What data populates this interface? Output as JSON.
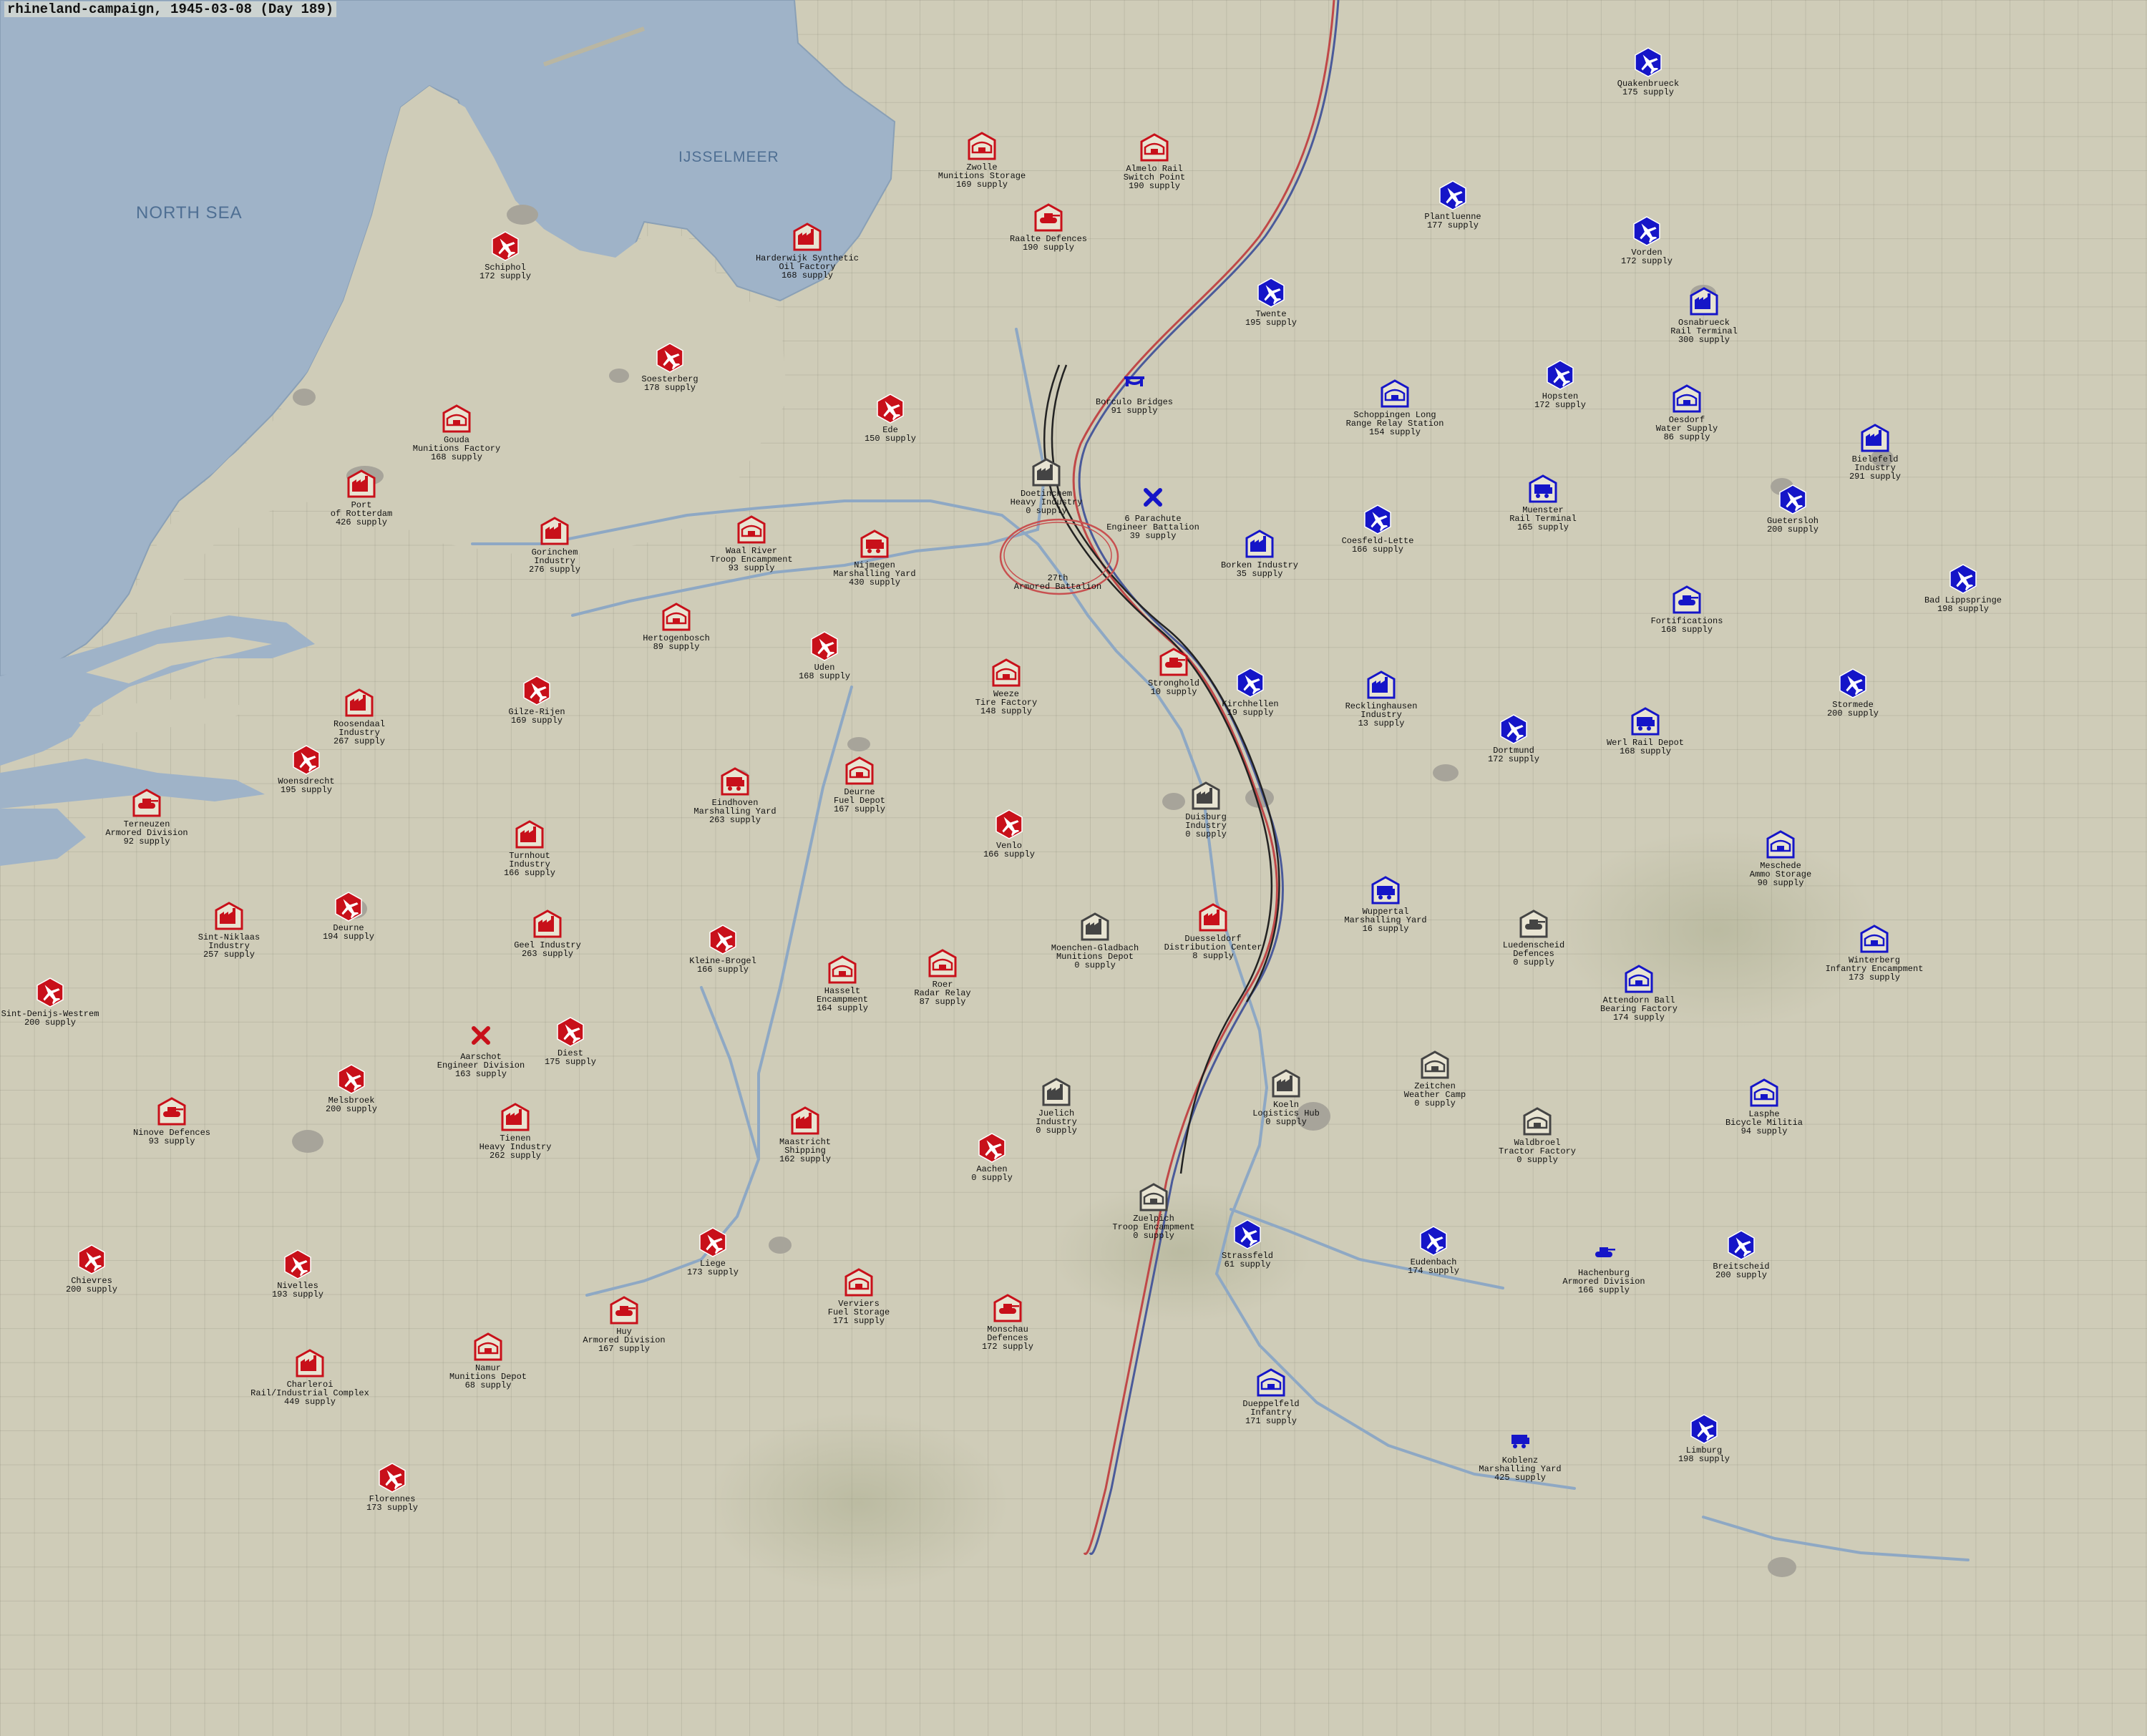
{
  "title": "rhineland-campaign, 1945-03-08 (Day 189)",
  "sea_labels": [
    {
      "id": "north-sea",
      "text": "NORTH SEA"
    },
    {
      "id": "ijsselmeer",
      "text": "IJSSELMEER"
    }
  ],
  "colors": {
    "land": "#cfccb8",
    "water": "#9fb3c8",
    "allied_red": "#c8101a",
    "axis_blue": "#1515c8",
    "neutral_gray": "#444444",
    "frontline_red": "#c04040",
    "frontline_blue": "#5a6aa0"
  },
  "units": [
    {
      "name": "Zwolle",
      "sub": "Munitions Storage",
      "supply": "169 supply",
      "side": "red",
      "shape": "house",
      "icon": "bunker-icon"
    },
    {
      "name": "Almelo Rail",
      "sub": "Switch Point",
      "supply": "190 supply",
      "side": "red",
      "shape": "house",
      "icon": "bunker-icon"
    },
    {
      "name": "Raalte Defences",
      "sub": "",
      "supply": "190 supply",
      "side": "red",
      "shape": "house",
      "icon": "tank-icon"
    },
    {
      "name": "Schiphol",
      "sub": "",
      "supply": "172 supply",
      "side": "red",
      "shape": "hex",
      "icon": "airfield-icon"
    },
    {
      "name": "Harderwijk Synthetic",
      "sub": "Oil Factory",
      "supply": "168 supply",
      "side": "red",
      "shape": "house",
      "icon": "factory-icon"
    },
    {
      "name": "Soesterberg",
      "sub": "",
      "supply": "178 supply",
      "side": "red",
      "shape": "hex",
      "icon": "airfield-icon"
    },
    {
      "name": "Gouda",
      "sub": "Munitions Factory",
      "supply": "168 supply",
      "side": "red",
      "shape": "house",
      "icon": "bunker-icon"
    },
    {
      "name": "Ede",
      "sub": "",
      "supply": "150 supply",
      "side": "red",
      "shape": "hex",
      "icon": "airfield-icon"
    },
    {
      "name": "Port",
      "sub": "of Rotterdam",
      "supply": "426 supply",
      "side": "red",
      "shape": "house",
      "icon": "factory-icon"
    },
    {
      "name": "Gorinchem",
      "sub": "Industry",
      "supply": "276 supply",
      "side": "red",
      "shape": "house",
      "icon": "factory-icon"
    },
    {
      "name": "Waal River",
      "sub": "Troop Encampment",
      "supply": "93 supply",
      "side": "red",
      "shape": "house",
      "icon": "bunker-icon"
    },
    {
      "name": "Nijmegen",
      "sub": "Marshalling Yard",
      "supply": "430 supply",
      "side": "red",
      "shape": "house",
      "icon": "train-icon"
    },
    {
      "name": "Doetinchem",
      "sub": "Heavy Industry",
      "supply": "0 supply",
      "side": "gray",
      "shape": "house",
      "icon": "factory-icon"
    },
    {
      "name": "",
      "sub": "27th\nArmored Battalion",
      "supply": "",
      "side": "red",
      "shape": "none",
      "icon": ""
    },
    {
      "name": "Hertogenbosch",
      "sub": "",
      "supply": "89 supply",
      "side": "red",
      "shape": "house",
      "icon": "bunker-icon"
    },
    {
      "name": "Uden",
      "sub": "",
      "supply": "168 supply",
      "side": "red",
      "shape": "hex",
      "icon": "airfield-icon"
    },
    {
      "name": "Gilze-Rijen",
      "sub": "",
      "supply": "169 supply",
      "side": "red",
      "shape": "hex",
      "icon": "airfield-icon"
    },
    {
      "name": "Roosendaal",
      "sub": "Industry",
      "supply": "267 supply",
      "side": "red",
      "shape": "house",
      "icon": "factory-icon"
    },
    {
      "name": "Woensdrecht",
      "sub": "",
      "supply": "195 supply",
      "side": "red",
      "shape": "hex",
      "icon": "airfield-icon"
    },
    {
      "name": "Weeze",
      "sub": "Tire Factory",
      "supply": "148 supply",
      "side": "red",
      "shape": "house",
      "icon": "bunker-icon"
    },
    {
      "name": "Stronghold",
      "sub": "",
      "supply": "10 supply",
      "side": "red",
      "shape": "house",
      "icon": "tank-icon"
    },
    {
      "name": "Eindhoven",
      "sub": "Marshalling Yard",
      "supply": "263 supply",
      "side": "red",
      "shape": "house",
      "icon": "train-icon"
    },
    {
      "name": "Deurne",
      "sub": "Fuel Depot",
      "supply": "167 supply",
      "side": "red",
      "shape": "house",
      "icon": "bunker-icon"
    },
    {
      "name": "Terneuzen",
      "sub": "Armored Division",
      "supply": "92 supply",
      "side": "red",
      "shape": "house",
      "icon": "tank-icon"
    },
    {
      "name": "Turnhout",
      "sub": "Industry",
      "supply": "166 supply",
      "side": "red",
      "shape": "house",
      "icon": "factory-icon"
    },
    {
      "name": "Venlo",
      "sub": "",
      "supply": "166 supply",
      "side": "red",
      "shape": "hex",
      "icon": "airfield-icon"
    },
    {
      "name": "Duisburg",
      "sub": "Industry",
      "supply": "0 supply",
      "side": "gray",
      "shape": "house",
      "icon": "factory-icon"
    },
    {
      "name": "Sint-Niklaas",
      "sub": "Industry",
      "supply": "257 supply",
      "side": "red",
      "shape": "house",
      "icon": "factory-icon"
    },
    {
      "name": "Deurne",
      "sub": "",
      "supply": "194 supply",
      "side": "red",
      "shape": "hex",
      "icon": "airfield-icon"
    },
    {
      "name": "Geel Industry",
      "sub": "",
      "supply": "263 supply",
      "side": "red",
      "shape": "house",
      "icon": "factory-icon"
    },
    {
      "name": "Kleine-Brogel",
      "sub": "",
      "supply": "166 supply",
      "side": "red",
      "shape": "hex",
      "icon": "airfield-icon"
    },
    {
      "name": "Roer",
      "sub": "Radar Relay",
      "supply": "87 supply",
      "side": "red",
      "shape": "house",
      "icon": "bunker-icon"
    },
    {
      "name": "Hasselt",
      "sub": "Encampment",
      "supply": "164 supply",
      "side": "red",
      "shape": "house",
      "icon": "bunker-icon"
    },
    {
      "name": "Moenchen-Gladbach",
      "sub": "Munitions Depot",
      "supply": "0 supply",
      "side": "gray",
      "shape": "house",
      "icon": "factory-icon"
    },
    {
      "name": "Duesseldorf",
      "sub": "Distribution Center",
      "supply": "8 supply",
      "side": "red",
      "shape": "house",
      "icon": "factory-icon"
    },
    {
      "name": "Sint-Denijs-Westrem",
      "sub": "",
      "supply": "200 supply",
      "side": "red",
      "shape": "hex",
      "icon": "airfield-icon"
    },
    {
      "name": "Aarschot",
      "sub": "Engineer Division",
      "supply": "163 supply",
      "side": "red",
      "shape": "none",
      "icon": "engineer-icon"
    },
    {
      "name": "Diest",
      "sub": "",
      "supply": "175 supply",
      "side": "red",
      "shape": "hex",
      "icon": "airfield-icon"
    },
    {
      "name": "Melsbroek",
      "sub": "",
      "supply": "200 supply",
      "side": "red",
      "shape": "hex",
      "icon": "airfield-icon"
    },
    {
      "name": "Ninove Defences",
      "sub": "",
      "supply": "93 supply",
      "side": "red",
      "shape": "house",
      "icon": "tank-icon"
    },
    {
      "name": "Tienen",
      "sub": "Heavy Industry",
      "supply": "262 supply",
      "side": "red",
      "shape": "house",
      "icon": "factory-icon"
    },
    {
      "name": "Maastricht",
      "sub": "Shipping",
      "supply": "162 supply",
      "side": "red",
      "shape": "house",
      "icon": "factory-icon"
    },
    {
      "name": "Juelich",
      "sub": "Industry",
      "supply": "0 supply",
      "side": "gray",
      "shape": "house",
      "icon": "factory-icon"
    },
    {
      "name": "Aachen",
      "sub": "",
      "supply": "0 supply",
      "side": "red",
      "shape": "hex",
      "icon": "airfield-icon"
    },
    {
      "name": "Koeln",
      "sub": "Logistics Hub",
      "supply": "0 supply",
      "side": "gray",
      "shape": "house",
      "icon": "factory-icon"
    },
    {
      "name": "Zuelpich",
      "sub": "Troop Encampment",
      "supply": "0 supply",
      "side": "gray",
      "shape": "house",
      "icon": "bunker-icon"
    },
    {
      "name": "Chievres",
      "sub": "",
      "supply": "200 supply",
      "side": "red",
      "shape": "hex",
      "icon": "airfield-icon"
    },
    {
      "name": "Nivelles",
      "sub": "",
      "supply": "193 supply",
      "side": "red",
      "shape": "hex",
      "icon": "airfield-icon"
    },
    {
      "name": "Liege",
      "sub": "",
      "supply": "173 supply",
      "side": "red",
      "shape": "hex",
      "icon": "airfield-icon"
    },
    {
      "name": "Verviers",
      "sub": "Fuel Storage",
      "supply": "171 supply",
      "side": "red",
      "shape": "house",
      "icon": "bunker-icon"
    },
    {
      "name": "Monschau",
      "sub": "Defences",
      "supply": "172 supply",
      "side": "red",
      "shape": "house",
      "icon": "tank-icon"
    },
    {
      "name": "Huy",
      "sub": "Armored Division",
      "supply": "167 supply",
      "side": "red",
      "shape": "house",
      "icon": "tank-icon"
    },
    {
      "name": "Namur",
      "sub": "Munitions Depot",
      "supply": "68 supply",
      "side": "red",
      "shape": "house",
      "icon": "bunker-icon"
    },
    {
      "name": "Charleroi",
      "sub": "Rail/Industrial Complex",
      "supply": "449 supply",
      "side": "red",
      "shape": "house",
      "icon": "factory-icon"
    },
    {
      "name": "Florennes",
      "sub": "",
      "supply": "173 supply",
      "side": "red",
      "shape": "hex",
      "icon": "airfield-icon"
    },
    {
      "name": "Quakenbrueck",
      "sub": "",
      "supply": "175 supply",
      "side": "blue",
      "shape": "hex",
      "icon": "airfield-icon"
    },
    {
      "name": "Plantluenne",
      "sub": "",
      "supply": "177 supply",
      "side": "blue",
      "shape": "hex",
      "icon": "airfield-icon"
    },
    {
      "name": "Vorden",
      "sub": "",
      "supply": "172 supply",
      "side": "blue",
      "shape": "hex",
      "icon": "airfield-icon"
    },
    {
      "name": "Twente",
      "sub": "",
      "supply": "195 supply",
      "side": "blue",
      "shape": "hex",
      "icon": "airfield-icon"
    },
    {
      "name": "Osnabrueck",
      "sub": "Rail Terminal",
      "supply": "300 supply",
      "side": "blue",
      "shape": "house",
      "icon": "factory-icon"
    },
    {
      "name": "Borculo Bridges",
      "sub": "",
      "supply": "91 supply",
      "side": "blue",
      "shape": "none",
      "icon": "bridge-icon"
    },
    {
      "name": "Hopsten",
      "sub": "",
      "supply": "172 supply",
      "side": "blue",
      "shape": "hex",
      "icon": "airfield-icon"
    },
    {
      "name": "Schoppingen Long",
      "sub": "Range Relay Station",
      "supply": "154 supply",
      "side": "blue",
      "shape": "house",
      "icon": "bunker-icon"
    },
    {
      "name": "Oesdorf",
      "sub": "Water Supply",
      "supply": "86 supply",
      "side": "blue",
      "shape": "house",
      "icon": "bunker-icon"
    },
    {
      "name": "Bielefeld",
      "sub": "Industry",
      "supply": "291 supply",
      "side": "blue",
      "shape": "house",
      "icon": "factory-icon"
    },
    {
      "name": "6 Parachute",
      "sub": "Engineer Battalion",
      "supply": "39 supply",
      "side": "blue",
      "shape": "none",
      "icon": "engineer-icon"
    },
    {
      "name": "Muenster",
      "sub": "Rail Terminal",
      "supply": "165 supply",
      "side": "blue",
      "shape": "house",
      "icon": "train-icon"
    },
    {
      "name": "Guetersloh",
      "sub": "",
      "supply": "200 supply",
      "side": "blue",
      "shape": "hex",
      "icon": "airfield-icon"
    },
    {
      "name": "Coesfeld-Lette",
      "sub": "",
      "supply": "166 supply",
      "side": "blue",
      "shape": "hex",
      "icon": "airfield-icon"
    },
    {
      "name": "Borken Industry",
      "sub": "",
      "supply": "35 supply",
      "side": "blue",
      "shape": "house",
      "icon": "factory-icon"
    },
    {
      "name": "Fortifications",
      "sub": "",
      "supply": "168 supply",
      "side": "blue",
      "shape": "house",
      "icon": "tank-icon"
    },
    {
      "name": "Bad Lippspringe",
      "sub": "",
      "supply": "198 supply",
      "side": "blue",
      "shape": "hex",
      "icon": "airfield-icon"
    },
    {
      "name": "Kirchhellen",
      "sub": "",
      "supply": "19 supply",
      "side": "blue",
      "shape": "hex",
      "icon": "airfield-icon"
    },
    {
      "name": "Recklinghausen",
      "sub": "Industry",
      "supply": "13 supply",
      "side": "blue",
      "shape": "house",
      "icon": "factory-icon"
    },
    {
      "name": "Dortmund",
      "sub": "",
      "supply": "172 supply",
      "side": "blue",
      "shape": "hex",
      "icon": "airfield-icon"
    },
    {
      "name": "Werl Rail Depot",
      "sub": "",
      "supply": "168 supply",
      "side": "blue",
      "shape": "house",
      "icon": "train-icon"
    },
    {
      "name": "Stormede",
      "sub": "",
      "supply": "200 supply",
      "side": "blue",
      "shape": "hex",
      "icon": "airfield-icon"
    },
    {
      "name": "Meschede",
      "sub": "Ammo Storage",
      "supply": "90 supply",
      "side": "blue",
      "shape": "house",
      "icon": "bunker-icon"
    },
    {
      "name": "Wuppertal",
      "sub": "Marshalling Yard",
      "supply": "16 supply",
      "side": "blue",
      "shape": "house",
      "icon": "train-icon"
    },
    {
      "name": "Luedenscheid",
      "sub": "Defences",
      "supply": "0 supply",
      "side": "gray",
      "shape": "house",
      "icon": "tank-icon"
    },
    {
      "name": "Winterberg",
      "sub": "Infantry Encampment",
      "supply": "173 supply",
      "side": "blue",
      "shape": "house",
      "icon": "bunker-icon"
    },
    {
      "name": "Attendorn Ball",
      "sub": "Bearing Factory",
      "supply": "174 supply",
      "side": "blue",
      "shape": "house",
      "icon": "bunker-icon"
    },
    {
      "name": "Zeitchen",
      "sub": "Weather Camp",
      "supply": "0 supply",
      "side": "gray",
      "shape": "house",
      "icon": "bunker-icon"
    },
    {
      "name": "Waldbroel",
      "sub": "Tractor Factory",
      "supply": "0 supply",
      "side": "gray",
      "shape": "house",
      "icon": "bunker-icon"
    },
    {
      "name": "Lasphe",
      "sub": "Bicycle Militia",
      "supply": "94 supply",
      "side": "blue",
      "shape": "house",
      "icon": "bunker-icon"
    },
    {
      "name": "Strassfeld",
      "sub": "",
      "supply": "61 supply",
      "side": "blue",
      "shape": "hex",
      "icon": "airfield-icon"
    },
    {
      "name": "Eudenbach",
      "sub": "",
      "supply": "174 supply",
      "side": "blue",
      "shape": "hex",
      "icon": "airfield-icon"
    },
    {
      "name": "Hachenburg",
      "sub": "Armored Division",
      "supply": "166 supply",
      "side": "blue",
      "shape": "none",
      "icon": "tank-icon"
    },
    {
      "name": "Breitscheid",
      "sub": "",
      "supply": "200 supply",
      "side": "blue",
      "shape": "hex",
      "icon": "airfield-icon"
    },
    {
      "name": "Dueppelfeld",
      "sub": "Infantry",
      "supply": "171 supply",
      "side": "blue",
      "shape": "house",
      "icon": "bunker-icon"
    },
    {
      "name": "Koblenz",
      "sub": "Marshalling Yard",
      "supply": "425 supply",
      "side": "blue",
      "shape": "none",
      "icon": "train-icon"
    },
    {
      "name": "Limburg",
      "sub": "",
      "supply": "198 supply",
      "side": "blue",
      "shape": "hex",
      "icon": "airfield-icon"
    }
  ]
}
